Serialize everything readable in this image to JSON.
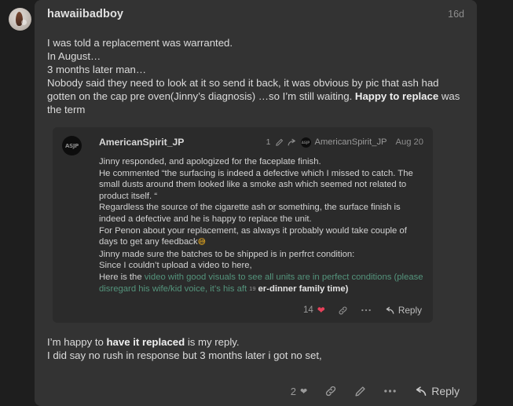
{
  "post": {
    "username": "hawaiibadboy",
    "timestamp": "16d",
    "avatar_name": "user-avatar",
    "body_lines": [
      [
        {
          "t": "I was told a replacement was warranted.",
          "b": false
        }
      ],
      [
        {
          "t": "In August…",
          "b": false
        }
      ],
      [
        {
          "t": "3 months later man…",
          "b": false
        }
      ],
      [
        {
          "t": "Nobody said they need to look at it so send it back, it was obvious by pic that ash had gotten on the cap pre oven(Jinny’s diagnosis) …so I’m still waiting. ",
          "b": false
        },
        {
          "t": "Happy to replace",
          "b": true
        },
        {
          "t": " was the term",
          "b": false
        }
      ]
    ],
    "body_after_quote": [
      [
        {
          "t": "I’m happy to ",
          "b": false
        },
        {
          "t": "have it replaced",
          "b": true
        },
        {
          "t": " is my reply.",
          "b": false
        }
      ],
      [
        {
          "t": "I did say no rush in response but 3 months later i got no set,",
          "b": false
        }
      ]
    ],
    "footer": {
      "like_count": "2",
      "heart_icon": "heart-icon",
      "link_icon": "link-icon",
      "edit_icon": "pencil-icon",
      "more_icon": "ellipsis-icon",
      "reply_icon": "reply-arrow-icon",
      "reply_label": "Reply"
    }
  },
  "quote": {
    "username": "AmericanSpirit_JP",
    "avatar_initials": "ASJP",
    "reply_count": "1",
    "edit_icon": "pencil-icon",
    "forward_icon": "reply-forward-arrow-icon",
    "reply_to_avatar_initials": "ASJP",
    "reply_to_username": "AmericanSpirit_JP",
    "date": "Aug 20",
    "body_lines": [
      [
        {
          "t": "Jinny responded, and apologized for the faceplate finish.",
          "k": "plain"
        }
      ],
      [
        {
          "t": "He commented “the surfacing is indeed a defective which I missed to catch. The small dusts around them looked like a smoke ash which seemed not related to product itself. “",
          "k": "plain"
        }
      ],
      [
        {
          "t": "Regardless the source of the cigarette ash or something, the surface finish is indeed a defective and he is happy to replace the unit.",
          "k": "plain"
        }
      ],
      [
        {
          "t": "For Penon about your replacement, as always it probably would take couple of days to get any feedback",
          "k": "plain"
        },
        {
          "t": "😅",
          "k": "emoji"
        }
      ],
      [
        {
          "t": "Jinny made sure the batches to be shipped is in perfrct condition:",
          "k": "plain"
        }
      ],
      [
        {
          "t": "Since I couldn’t upload a video to here,",
          "k": "plain"
        }
      ],
      [
        {
          "t": "Here is the ",
          "k": "plain"
        },
        {
          "t": "video with good visuals to see all units are in perfect conditions (please disregard his wife/kid voice, it’s his aft",
          "k": "link"
        },
        {
          "t": "19",
          "k": "sup"
        },
        {
          "t": "er-dinner family time)",
          "k": "bold"
        }
      ]
    ],
    "footer": {
      "like_count": "14",
      "heart_icon": "heart-filled-icon",
      "link_icon": "link-icon",
      "more_icon": "ellipsis-icon",
      "reply_icon": "reply-arrow-icon",
      "reply_label": "Reply"
    }
  },
  "colors": {
    "page_background": "#1e1e1e",
    "card_background": "#333333",
    "quote_background": "#2b2b2b",
    "text_primary": "#dcdcdc",
    "text_muted": "#8e8e8e",
    "link_green": "#54947c",
    "heart_red": "#e8415a"
  }
}
